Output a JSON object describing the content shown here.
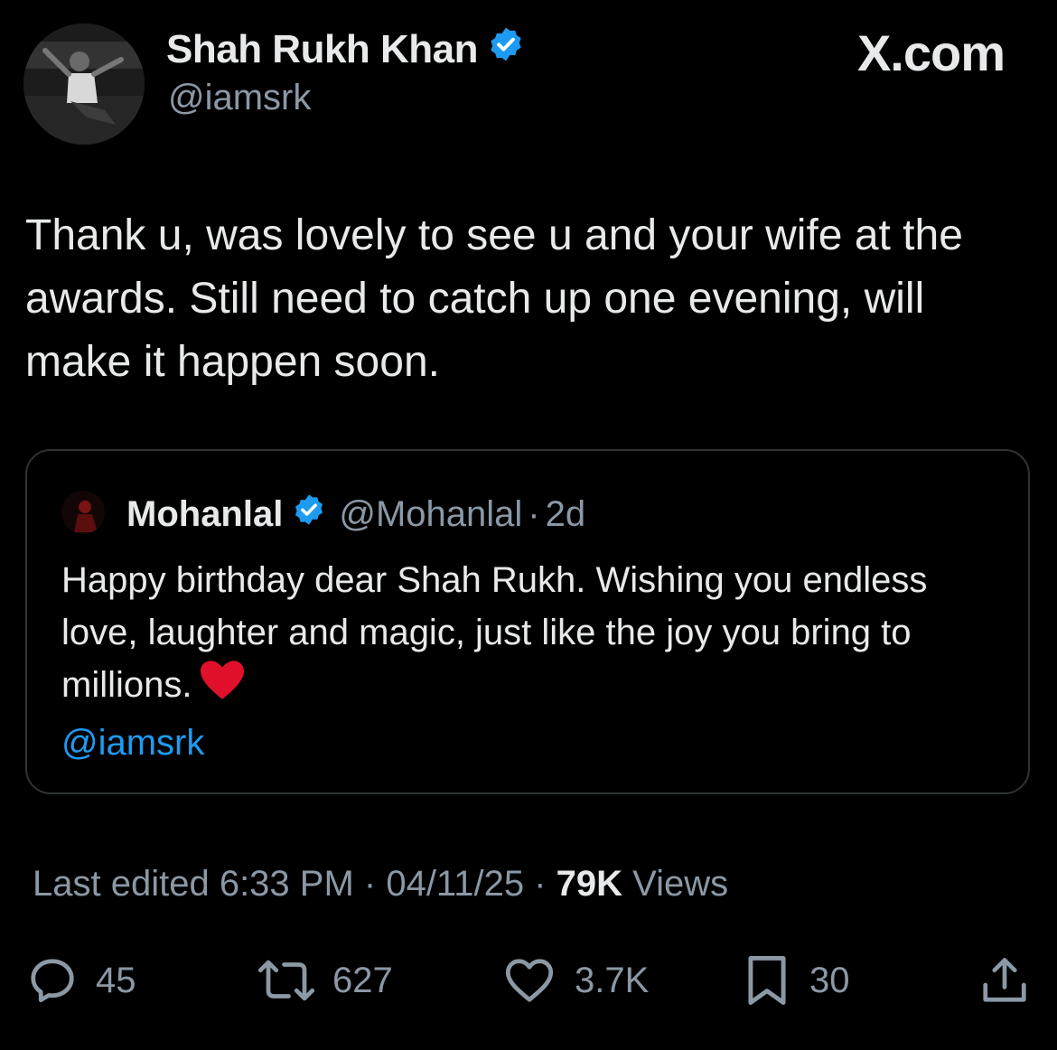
{
  "author": {
    "name": "Shah Rukh Khan",
    "handle": "@iamsrk",
    "verified": true
  },
  "brand": "X.com",
  "tweet": {
    "text": "Thank u, was lovely to see u and your wife at the awards. Still need to catch up one evening, will make it happen soon."
  },
  "quote": {
    "name": "Mohanlal",
    "handle": "@Mohanlal",
    "separator": "·",
    "time": "2d",
    "text": "Happy birthday dear Shah Rukh. Wishing you endless love, laughter and magic, just like the joy you bring to millions.",
    "mention": "@iamsrk"
  },
  "meta": {
    "edited": "Last edited 6:33 PM · 04/11/25 ·",
    "views_count": "79K",
    "views_label": "Views"
  },
  "actions": {
    "replies": "45",
    "reposts": "627",
    "likes": "3.7K",
    "bookmarks": "30"
  },
  "colors": {
    "background": "#000000",
    "text": "#e7e9ea",
    "muted": "#8b98a5",
    "accent": "#1d9bf0",
    "heart": "#e0102b"
  }
}
